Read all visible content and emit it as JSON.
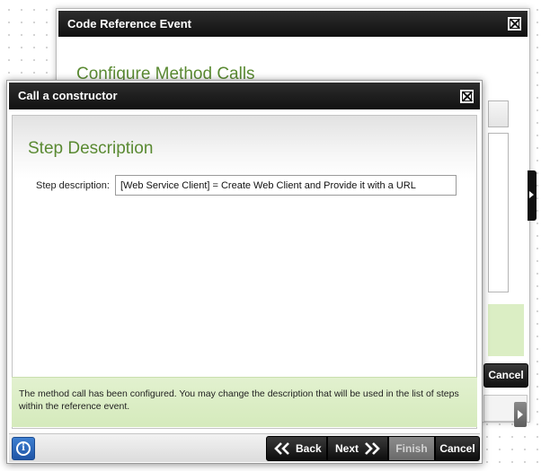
{
  "back_window": {
    "title": "Code Reference Event",
    "heading": "Configure Method Calls",
    "cancel_label": "Cancel"
  },
  "front_window": {
    "title": "Call a constructor",
    "heading": "Step Description",
    "field_label": "Step description:",
    "field_value": "[Web Service Client] = Create Web Client and Provide it with a URL",
    "info_text": "The method call has been configured. You may change the description that will be used in the list of steps within the reference event."
  },
  "footer": {
    "info_icon": "i",
    "back_label": "Back",
    "next_label": "Next",
    "finish_label": "Finish",
    "cancel_label": "Cancel"
  },
  "colors": {
    "heading_green": "#5a8a32",
    "info_panel_green": "#d9ecc3",
    "titlebar": "#1a1a1a",
    "info_button_blue": "#2a64b8",
    "finish_disabled": "#7a7a7a"
  },
  "icons": {
    "close": "close-icon",
    "info": "info-icon",
    "back": "double-chevron-left-icon",
    "next": "double-chevron-right-icon"
  }
}
